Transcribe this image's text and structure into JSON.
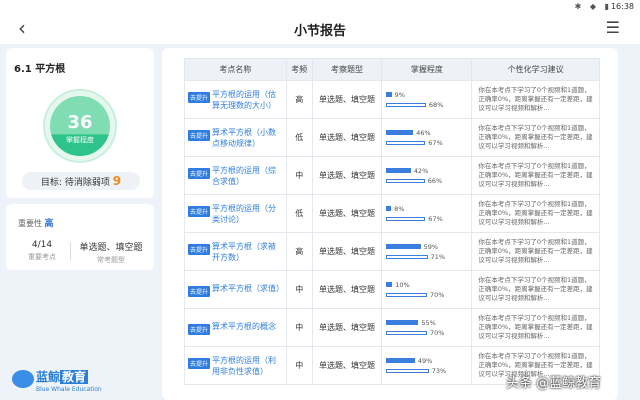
{
  "status": {
    "time": "16:38",
    "icons": "✱ ◆ ▮"
  },
  "header": {
    "title": "小节报告"
  },
  "left": {
    "section_title": "6.1 平方根",
    "gauge_value": "36",
    "gauge_fraction": 0.36,
    "gauge_label": "掌握程度",
    "target_label": "目标:",
    "target_text": "待消除弱项",
    "target_count": "9",
    "importance_label": "重要性",
    "importance_value": "高",
    "points_value": "4/14",
    "points_label": "重要考点",
    "types_value": "单选题、填空题",
    "types_label": "常考题型"
  },
  "logo": {
    "cn_a": "蓝鲸",
    "cn_b": "教育",
    "en": "Blue Whale Education"
  },
  "table": {
    "headers": [
      "考点名称",
      "考频",
      "考察题型",
      "掌握程度",
      "个性化学习建议"
    ],
    "tag_label": "去提升",
    "suggestion": "你在本考点下学习了0个视频和1道题，正确率0%，距离掌握还有一定差距，建议可以学习视频和解析...",
    "rows": [
      {
        "name": "平方根的运用（估算无理数的大小）",
        "freq": "高",
        "type": "单选题、填空题",
        "a": 9,
        "b": 68
      },
      {
        "name": "算术平方根（小数点移动规律）",
        "freq": "低",
        "type": "单选题、填空题",
        "a": 46,
        "b": 67
      },
      {
        "name": "平方根的运用（综合求值）",
        "freq": "中",
        "type": "单选题、填空题",
        "a": 42,
        "b": 66
      },
      {
        "name": "平方根的运用（分类讨论）",
        "freq": "低",
        "type": "单选题、填空题",
        "a": 8,
        "b": 67
      },
      {
        "name": "算术平方根（求被开方数）",
        "freq": "高",
        "type": "单选题、填空题",
        "a": 59,
        "b": 71
      },
      {
        "name": "算术平方根（求值）",
        "freq": "中",
        "type": "单选题、填空题",
        "a": 10,
        "b": 70
      },
      {
        "name": "算术平方根的概念",
        "freq": "中",
        "type": "单选题、填空题",
        "a": 55,
        "b": 70
      },
      {
        "name": "平方根的运用（利用非负性求值）",
        "freq": "中",
        "type": "单选题、填空题",
        "a": 49,
        "b": 73
      }
    ]
  },
  "watermark": "头条 @蓝鲸教育",
  "colors": {
    "accent": "#2f7de0",
    "highlight": "#f08a1c",
    "gauge": "#2ec38a"
  }
}
